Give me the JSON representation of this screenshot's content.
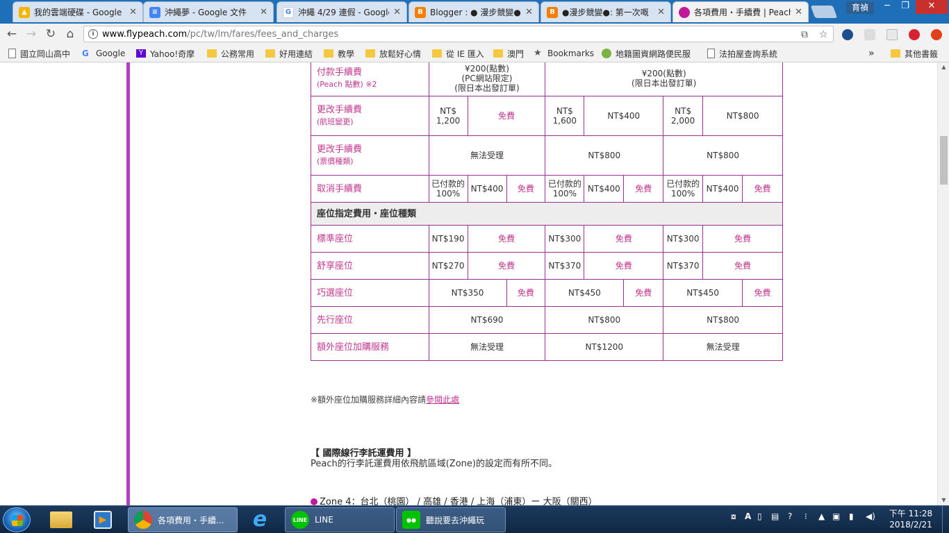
{
  "browser": {
    "tabs": [
      {
        "title": "我的雲端硬碟 - Google",
        "icon": "google-drive-icon",
        "color": "#f4b400"
      },
      {
        "title": "沖繩夢 - Google 文件",
        "icon": "google-docs-icon",
        "color": "#4285f4"
      },
      {
        "title": "沖繩 4/29 連假 - Google",
        "icon": "google-icon",
        "color": "#4285f4"
      },
      {
        "title": "Blogger : ● 漫步競變●",
        "icon": "blogger-icon",
        "color": "#f57d00"
      },
      {
        "title": "●漫步競變●: 第一次嘅",
        "icon": "blogger-icon",
        "color": "#f57d00"
      },
      {
        "title": "各項費用・手續費 | Peach",
        "icon": "peach-icon",
        "color": "#c2189a"
      }
    ],
    "user_label": "育禎",
    "url_host": "www.flypeach.com",
    "url_path": "/pc/tw/lm/fares/fees_and_charges",
    "bookmarks": [
      {
        "label": "國立岡山高中",
        "icon": "page"
      },
      {
        "label": "Google",
        "icon": "google"
      },
      {
        "label": "Yahoo!奇摩",
        "icon": "yahoo"
      },
      {
        "label": "公務常用",
        "icon": "folder"
      },
      {
        "label": "好用連結",
        "icon": "folder"
      },
      {
        "label": "教學",
        "icon": "folder"
      },
      {
        "label": "放鬆好心情",
        "icon": "folder"
      },
      {
        "label": "從 IE 匯入",
        "icon": "folder"
      },
      {
        "label": "澳門",
        "icon": "folder"
      },
      {
        "label": "Bookmarks",
        "icon": "star"
      },
      {
        "label": "地籍圖資網路便民服",
        "icon": "globe"
      },
      {
        "label": "法拍屋查詢系統",
        "icon": "page"
      }
    ],
    "other_bookmarks": "其他書籤",
    "chevron": "»"
  },
  "table": {
    "payment_fee": {
      "label": "付款手續費",
      "sub": "(Peach 點數) ※2",
      "col1": [
        "¥200(點數)",
        "(PC網站限定)",
        "(限日本出發訂單)"
      ],
      "col23": [
        "¥200(點數)",
        "(限日本出發訂單)"
      ]
    },
    "change_flight": {
      "label": "更改手續費",
      "sub": "(航班變更)",
      "values": [
        "NT$ 1,200",
        "免費",
        "NT$ 1,600",
        "NT$400",
        "NT$ 2,000",
        "NT$800"
      ]
    },
    "change_fare": {
      "label": "更改手續費",
      "sub": "(票價種類)",
      "values": [
        "無法受理",
        "NT$800",
        "NT$800"
      ]
    },
    "cancel": {
      "label": "取消手續費",
      "paid": "已付款的 100%",
      "values": [
        "NT$400",
        "免費"
      ]
    },
    "seat_section": "座位指定費用・座位種類",
    "seats": [
      {
        "label": "標準座位",
        "values": [
          "NT$190",
          "免費",
          "NT$300",
          "免費",
          "NT$300",
          "免費"
        ]
      },
      {
        "label": "舒享座位",
        "values": [
          "NT$270",
          "免費",
          "NT$370",
          "免費",
          "NT$370",
          "免費"
        ]
      },
      {
        "label": "巧選座位",
        "values": [
          "NT$350",
          "免費",
          "NT$450",
          "免費",
          "NT$450",
          "免費"
        ]
      },
      {
        "label": "先行座位",
        "values": [
          "NT$690",
          "NT$800",
          "NT$800"
        ]
      },
      {
        "label": "額外座位加購服務",
        "values": [
          "無法受理",
          "NT$1200",
          "無法受理"
        ]
      }
    ]
  },
  "note": {
    "prefix": "※額外座位加購服務詳細內容請",
    "link": "參閱此處"
  },
  "baggage": {
    "title": "【 國際線行李託運費用 】",
    "desc": "Peach的行李託運費用依飛航區域(Zone)的設定而有所不同。",
    "zone": "Zone 4：台北（桃園） / 高雄 / 香港 / 上海（浦東）ー 大阪（關西）"
  },
  "taskbar": {
    "tasks": [
      {
        "label": "各項費用・手續...",
        "icon": "chrome-icon"
      },
      {
        "label": "LINE",
        "icon": "line-icon"
      },
      {
        "label": "聽說要去沖繩玩",
        "icon": "line-group-icon"
      }
    ],
    "time": "下午 11:28",
    "date": "2018/2/21"
  }
}
